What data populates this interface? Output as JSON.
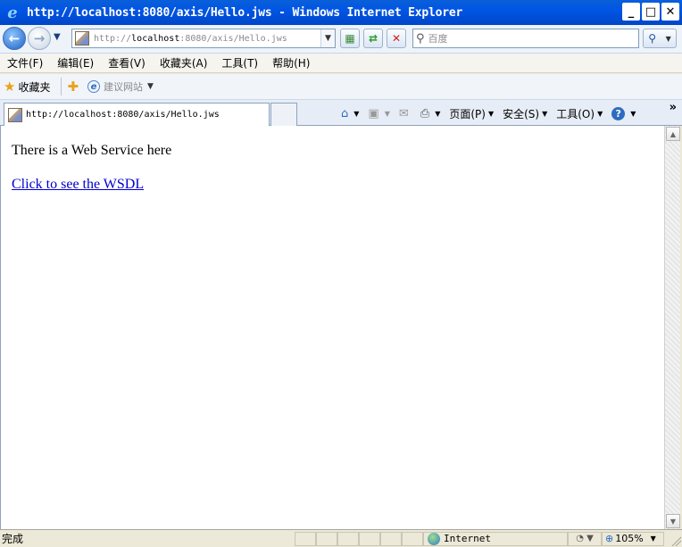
{
  "window": {
    "title": "http://localhost:8080/axis/Hello.jws - Windows Internet Explorer",
    "buttons": {
      "minimize": "_",
      "maximize": "□",
      "close": "✕"
    }
  },
  "address": {
    "url_prefix": "http://",
    "url_host": "localhost",
    "url_rest": ":8080/axis/Hello.jws",
    "search_placeholder": "百度"
  },
  "menu": {
    "items": [
      "文件(F)",
      "编辑(E)",
      "查看(V)",
      "收藏夹(A)",
      "工具(T)",
      "帮助(H)"
    ]
  },
  "favorites": {
    "label": "收藏夹",
    "suggested": "建议网站"
  },
  "tab": {
    "title": "http://localhost:8080/axis/Hello.jws"
  },
  "commands": {
    "page": "页面(P)",
    "safety": "安全(S)",
    "tools": "工具(O)",
    "more": "»"
  },
  "content": {
    "text": "There is a Web Service here",
    "link": "Click to see the WSDL"
  },
  "status": {
    "text": "完成",
    "zone": "Internet",
    "zoom": "105%"
  },
  "icons": [
    "ie-logo-icon",
    "back-arrow-icon",
    "forward-arrow-icon",
    "page-icon",
    "refresh-icon",
    "stop-icon",
    "search-icon",
    "star-icon",
    "home-icon",
    "feeds-icon",
    "mail-icon",
    "print-icon",
    "help-icon",
    "globe-icon",
    "zoom-icon"
  ]
}
